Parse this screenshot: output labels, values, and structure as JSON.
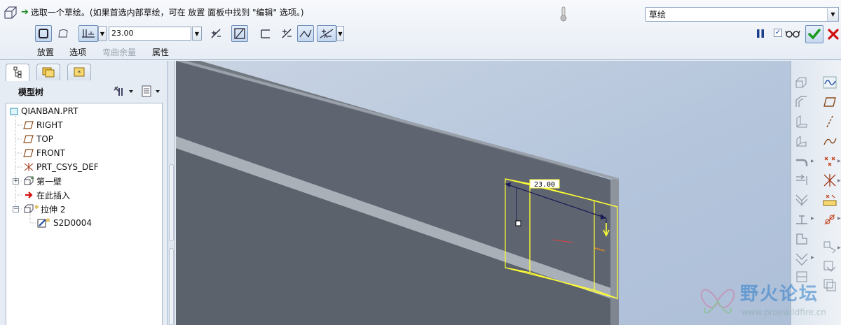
{
  "dashboard": {
    "message": "选取一个草绘。(如果首选内部草绘，可在 放置 面板中找到 \"编辑\" 选项。)",
    "mode_value": "草绘",
    "depth_value": "23.00",
    "tabs": [
      {
        "label": "放置",
        "enabled": true
      },
      {
        "label": "选项",
        "enabled": true
      },
      {
        "label": "弯曲余量",
        "enabled": false
      },
      {
        "label": "属性",
        "enabled": true
      }
    ],
    "preview_checked": "✓"
  },
  "navigator": {
    "title": "模型树",
    "tree": [
      {
        "label": "QIANBAN.PRT",
        "icon": "part-icon",
        "level": 0
      },
      {
        "label": "RIGHT",
        "icon": "datum-plane-icon",
        "level": 1
      },
      {
        "label": "TOP",
        "icon": "datum-plane-icon",
        "level": 1
      },
      {
        "label": "FRONT",
        "icon": "datum-plane-icon",
        "level": 1
      },
      {
        "label": "PRT_CSYS_DEF",
        "icon": "csys-icon",
        "level": 1
      },
      {
        "label": "第一壁",
        "icon": "sheetmetal-wall-icon",
        "level": 1
      },
      {
        "label": "在此插入",
        "icon": "insert-here-icon",
        "level": 1
      },
      {
        "label": "拉伸 2",
        "icon": "extrude-icon",
        "level": 1
      },
      {
        "label": "S2D0004",
        "icon": "sketch-icon",
        "level": 2
      }
    ]
  },
  "graphics": {
    "dimension_label": "23.00"
  },
  "watermark": {
    "title": "野火论坛",
    "url": "www.proewildfire.cn"
  },
  "colors": {
    "part_dark": "#5f6570",
    "part_light": "#9aa1aa",
    "highlight": "#ffff33",
    "accept": "#1a9a1a",
    "cancel": "#d01010"
  }
}
